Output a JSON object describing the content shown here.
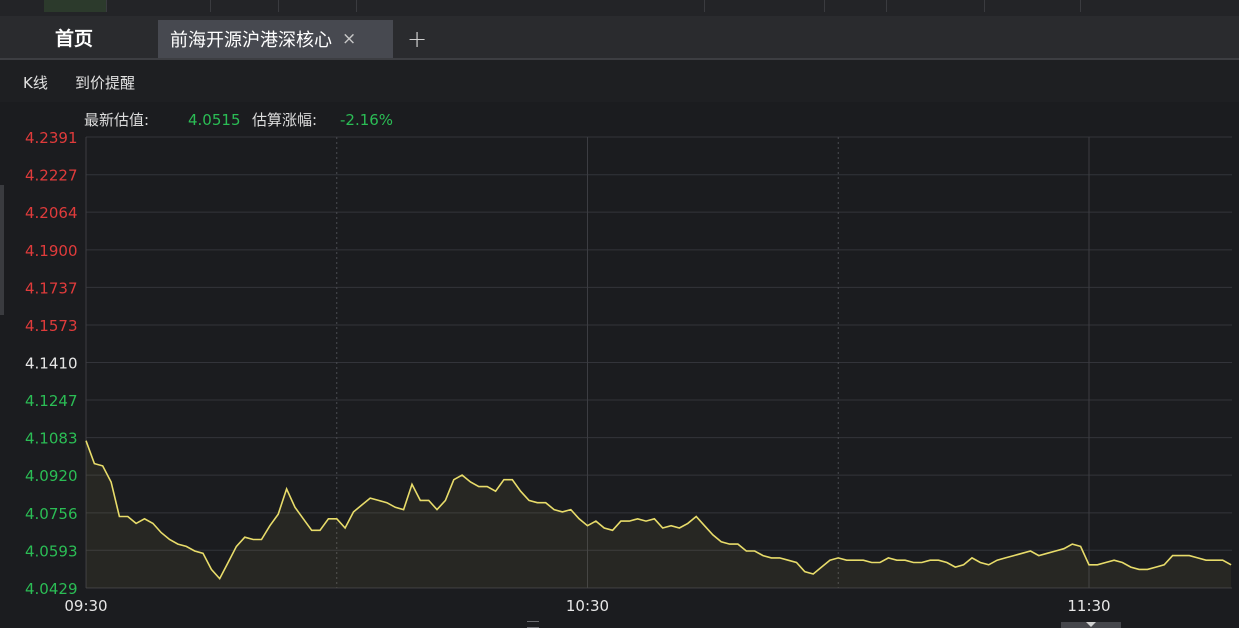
{
  "tabs": {
    "home_label": "首页",
    "active_label": "前海开源沪港深核心",
    "close_glyph": "×",
    "add_glyph": "+"
  },
  "toolbar": {
    "kline_label": "K线",
    "alert_label": "到价提醒"
  },
  "header": {
    "latest_label": "最新估值:",
    "latest_value": "4.0515",
    "change_label": "估算涨幅:",
    "change_value": "-2.16%"
  },
  "colors": {
    "up": "#e03b3b",
    "neutral": "#e6e6e6",
    "down": "#2bbd55",
    "line": "#e8dc6a"
  },
  "chart_data": {
    "type": "line",
    "title": "",
    "xlabel": "",
    "ylabel": "",
    "ylim": [
      4.0429,
      4.2391
    ],
    "yticks": [
      {
        "label": "4.2391",
        "value": 4.2391,
        "tone": "up"
      },
      {
        "label": "4.2227",
        "value": 4.2227,
        "tone": "up"
      },
      {
        "label": "4.2064",
        "value": 4.2064,
        "tone": "up"
      },
      {
        "label": "4.1900",
        "value": 4.19,
        "tone": "up"
      },
      {
        "label": "4.1737",
        "value": 4.1737,
        "tone": "up"
      },
      {
        "label": "4.1573",
        "value": 4.1573,
        "tone": "up"
      },
      {
        "label": "4.1410",
        "value": 4.141,
        "tone": "neutral"
      },
      {
        "label": "4.1247",
        "value": 4.1247,
        "tone": "down"
      },
      {
        "label": "4.1083",
        "value": 4.1083,
        "tone": "down"
      },
      {
        "label": "4.0920",
        "value": 4.092,
        "tone": "down"
      },
      {
        "label": "4.0756",
        "value": 4.0756,
        "tone": "down"
      },
      {
        "label": "4.0593",
        "value": 4.0593,
        "tone": "down"
      },
      {
        "label": "4.0429",
        "value": 4.0429,
        "tone": "down"
      }
    ],
    "xrange_minutes": [
      0,
      114
    ],
    "xticks": [
      {
        "label": "09:30",
        "minute": 0
      },
      {
        "label": "10:30",
        "minute": 60
      },
      {
        "label": "11:30",
        "minute": 120
      }
    ],
    "dashed_minutes": [
      30,
      90
    ],
    "grid": true,
    "x_minutes": [
      0,
      1,
      2,
      3,
      4,
      5,
      6,
      7,
      8,
      9,
      10,
      11,
      12,
      13,
      14,
      15,
      16,
      17,
      18,
      19,
      20,
      21,
      22,
      23,
      24,
      25,
      26,
      27,
      28,
      29,
      30,
      31,
      32,
      33,
      34,
      35,
      36,
      37,
      38,
      39,
      40,
      41,
      42,
      43,
      44,
      45,
      46,
      47,
      48,
      49,
      50,
      51,
      52,
      53,
      54,
      55,
      56,
      57,
      58,
      59,
      60,
      61,
      62,
      63,
      64,
      65,
      66,
      67,
      68,
      69,
      70,
      71,
      72,
      73,
      74,
      75,
      76,
      77,
      78,
      79,
      80,
      81,
      82,
      83,
      84,
      85,
      86,
      87,
      88,
      89,
      90,
      91,
      92,
      93,
      94,
      95,
      96,
      97,
      98,
      99,
      100,
      101,
      102,
      103,
      104,
      105,
      106,
      107,
      108,
      109,
      110,
      111,
      112,
      113,
      114,
      115,
      116,
      117,
      118,
      119,
      120,
      121,
      122,
      123,
      124,
      125,
      126,
      127,
      128,
      129,
      130,
      131,
      132,
      133,
      134,
      135,
      136,
      137
    ],
    "values": [
      4.107,
      4.097,
      4.096,
      4.089,
      4.074,
      4.074,
      4.071,
      4.073,
      4.071,
      4.067,
      4.064,
      4.062,
      4.061,
      4.059,
      4.058,
      4.051,
      4.047,
      4.054,
      4.061,
      4.065,
      4.064,
      4.064,
      4.07,
      4.075,
      4.086,
      4.078,
      4.073,
      4.068,
      4.068,
      4.073,
      4.073,
      4.069,
      4.076,
      4.079,
      4.082,
      4.081,
      4.08,
      4.078,
      4.077,
      4.088,
      4.081,
      4.081,
      4.077,
      4.081,
      4.09,
      4.092,
      4.089,
      4.087,
      4.087,
      4.085,
      4.09,
      4.09,
      4.085,
      4.081,
      4.08,
      4.08,
      4.077,
      4.076,
      4.077,
      4.073,
      4.07,
      4.072,
      4.069,
      4.068,
      4.072,
      4.072,
      4.073,
      4.072,
      4.073,
      4.069,
      4.07,
      4.069,
      4.071,
      4.074,
      4.07,
      4.066,
      4.063,
      4.062,
      4.062,
      4.059,
      4.059,
      4.057,
      4.056,
      4.056,
      4.055,
      4.054,
      4.05,
      4.049,
      4.052,
      4.055,
      4.056,
      4.055,
      4.055,
      4.055,
      4.054,
      4.054,
      4.056,
      4.055,
      4.055,
      4.054,
      4.054,
      4.055,
      4.055,
      4.054,
      4.052,
      4.053,
      4.056,
      4.054,
      4.053,
      4.055,
      4.056,
      4.057,
      4.058,
      4.059,
      4.057,
      4.058,
      4.059,
      4.06,
      4.062,
      4.061,
      4.053,
      4.053,
      4.054,
      4.055,
      4.054,
      4.052,
      4.051,
      4.051,
      4.052,
      4.053,
      4.057,
      4.057,
      4.057,
      4.056,
      4.055,
      4.055,
      4.055,
      4.053
    ]
  }
}
